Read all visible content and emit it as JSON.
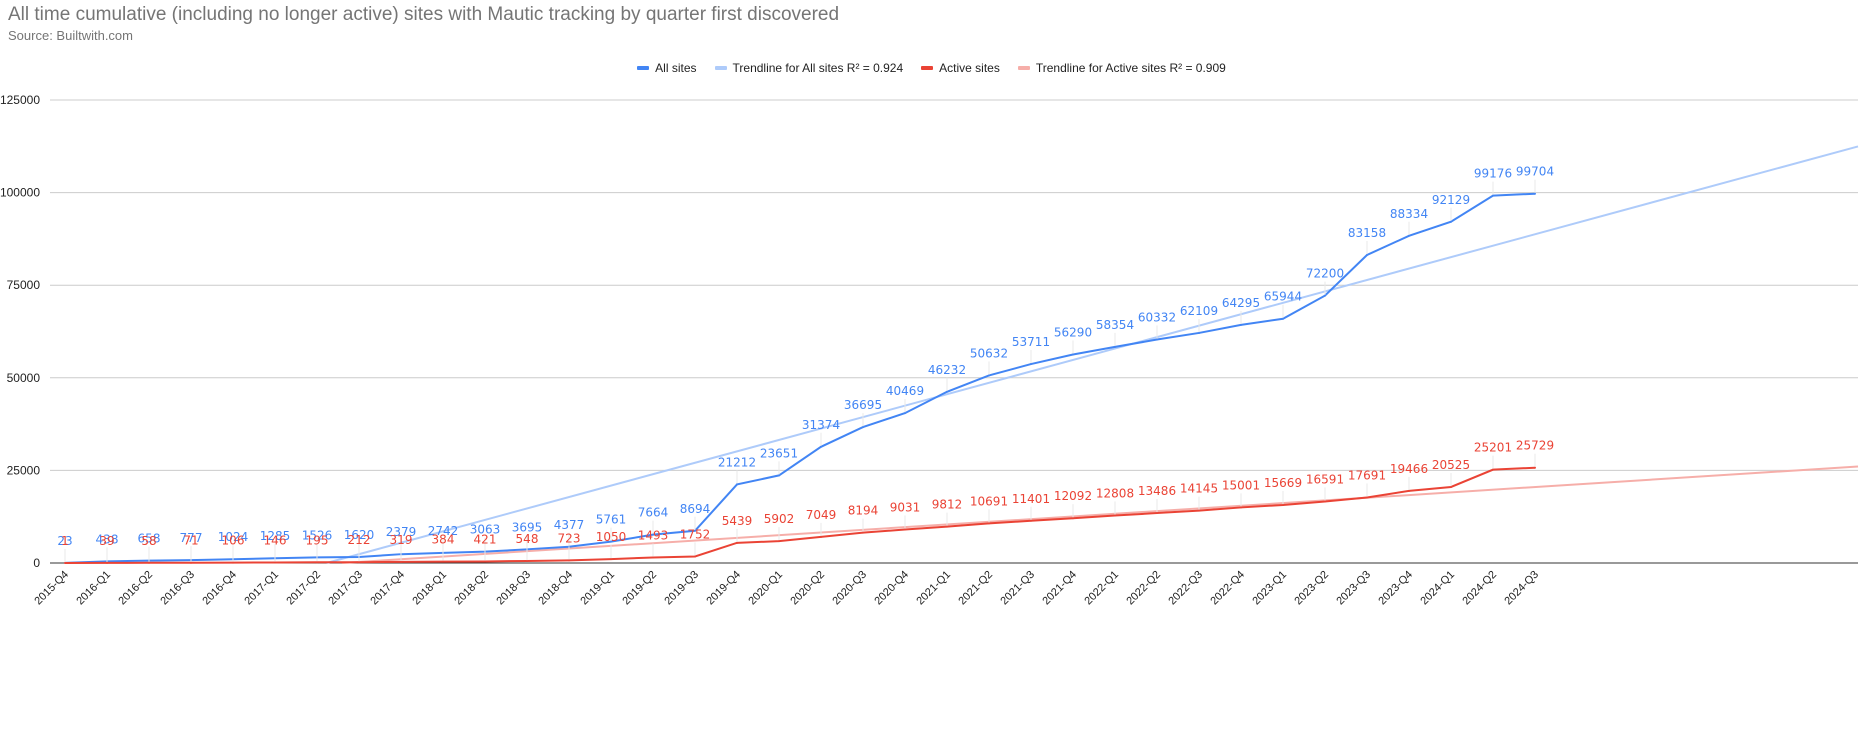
{
  "chart_data": {
    "type": "line",
    "title": "All time cumulative (including no longer active) sites with Mautic tracking by quarter first discovered",
    "subtitle": "Source: Builtwith.com",
    "xlabel": "",
    "ylabel": "",
    "ylim": [
      0,
      125000
    ],
    "yticks": [
      "0",
      "25000",
      "50000",
      "75000",
      "100000",
      "125000"
    ],
    "grid": true,
    "legend_position": "top",
    "categories": [
      "2015-Q4",
      "2016-Q1",
      "2016-Q2",
      "2016-Q3",
      "2016-Q4",
      "2017-Q1",
      "2017-Q2",
      "2017-Q3",
      "2017-Q4",
      "2018-Q1",
      "2018-Q2",
      "2018-Q3",
      "2018-Q4",
      "2019-Q1",
      "2019-Q2",
      "2019-Q3",
      "2019-Q4",
      "2020-Q1",
      "2020-Q2",
      "2020-Q3",
      "2020-Q4",
      "2021-Q1",
      "2021-Q2",
      "2021-Q3",
      "2021-Q4",
      "2022-Q1",
      "2022-Q2",
      "2022-Q3",
      "2022-Q4",
      "2023-Q1",
      "2023-Q2",
      "2023-Q3",
      "2023-Q4",
      "2024-Q1",
      "2024-Q2",
      "2024-Q3"
    ],
    "series": [
      {
        "name": "All sites",
        "color": "#4285f4",
        "values": [
          23,
          438,
          658,
          777,
          1024,
          1285,
          1526,
          1620,
          2379,
          2742,
          3063,
          3695,
          4377,
          5761,
          7664,
          8694,
          21212,
          23651,
          31374,
          36695,
          40469,
          46232,
          50632,
          53711,
          56290,
          58354,
          60332,
          62109,
          64295,
          65944,
          72200,
          83158,
          88334,
          92129,
          99176,
          99704
        ]
      },
      {
        "name": "Trendline for All sites R² = 0.924",
        "color": "#aecbfa",
        "trendline_of": "All sites",
        "r2": 0.924
      },
      {
        "name": "Active sites",
        "color": "#ea4335",
        "values": [
          1,
          39,
          58,
          71,
          106,
          146,
          195,
          212,
          319,
          384,
          421,
          548,
          723,
          1050,
          1493,
          1752,
          5439,
          5902,
          7049,
          8194,
          9031,
          9812,
          10691,
          11401,
          12092,
          12808,
          13486,
          14145,
          15001,
          15669,
          16591,
          17691,
          19466,
          20525,
          25201,
          25729
        ]
      },
      {
        "name": "Trendline for Active sites R² = 0.909",
        "color": "#f6aea9",
        "trendline_of": "Active sites",
        "r2": 0.909
      }
    ]
  }
}
